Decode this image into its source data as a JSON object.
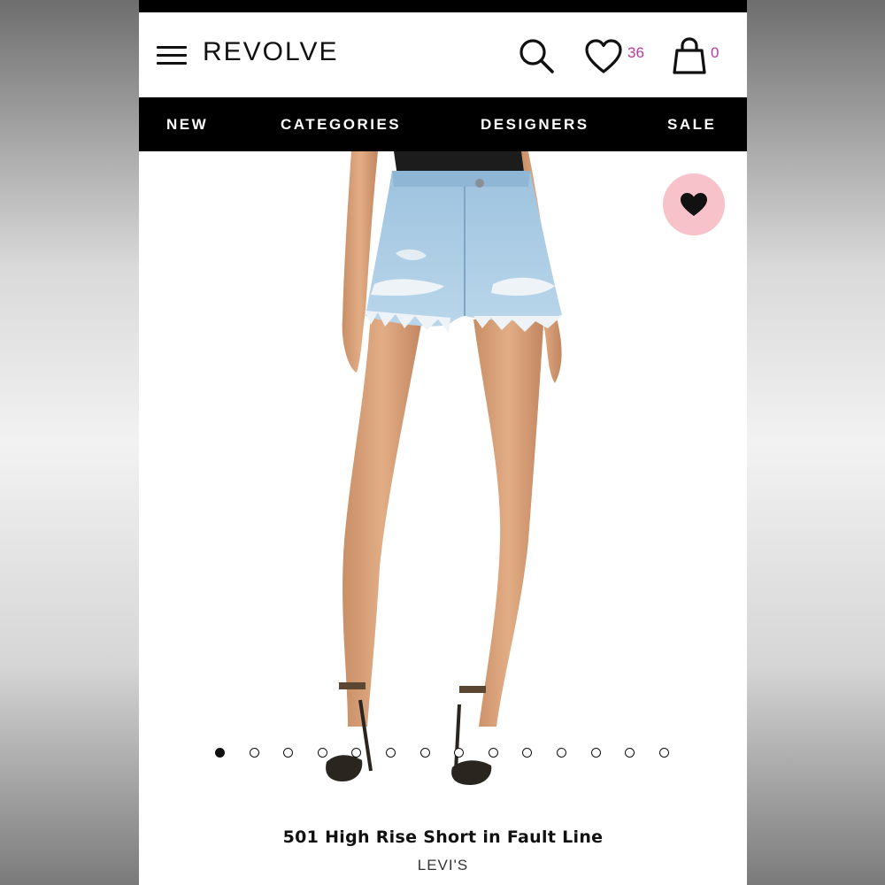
{
  "header": {
    "logo": "REVOLVE",
    "wishlist_count": "36",
    "bag_count": "0",
    "menu_icon": "hamburger-menu-icon",
    "search_icon": "search-icon",
    "wishlist_icon": "heart-outline-icon",
    "bag_icon": "shopping-bag-icon"
  },
  "nav": {
    "items": [
      {
        "label": "NEW"
      },
      {
        "label": "CATEGORIES"
      },
      {
        "label": "DESIGNERS"
      },
      {
        "label": "SALE"
      }
    ]
  },
  "product": {
    "title": "501 High Rise Short in Fault Line",
    "brand": "LEVI'S",
    "image_count": 14,
    "active_image": 1,
    "favorite_icon": "heart-filled-icon"
  },
  "colors": {
    "accent_count": "#c0389a",
    "favorite_bg": "#f7c2c9",
    "nav_bg": "#000000"
  }
}
